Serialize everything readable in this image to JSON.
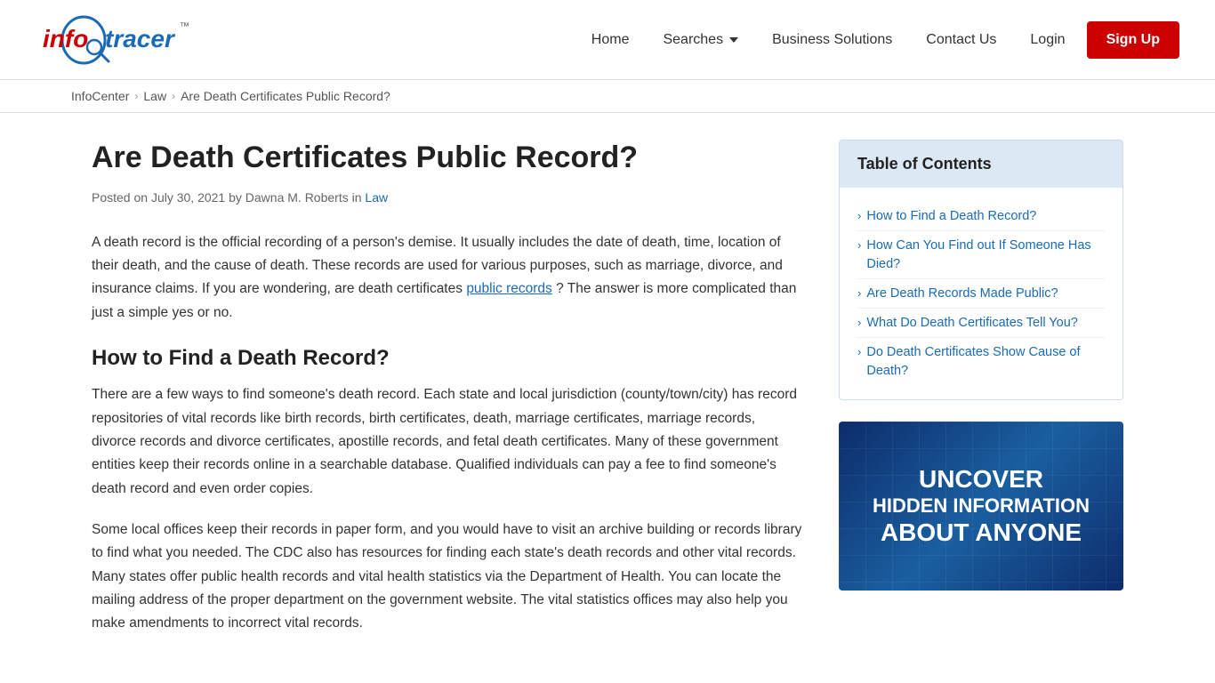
{
  "header": {
    "logo_text_red": "info",
    "logo_text_blue": "tracer",
    "logo_tm": "™",
    "nav": {
      "home": "Home",
      "searches": "Searches",
      "business_solutions": "Business Solutions",
      "contact_us": "Contact Us",
      "login": "Login",
      "signup": "Sign Up"
    }
  },
  "breadcrumb": {
    "infocenter": "InfoCenter",
    "law": "Law",
    "current": "Are Death Certificates Public Record?"
  },
  "article": {
    "title": "Are Death Certificates Public Record?",
    "meta": "Posted on July 30, 2021 by Dawna M. Roberts in",
    "meta_category": "Law",
    "intro_p1": "A death record is the official recording of a person's demise. It usually includes the date of death, time, location of their death, and the cause of death. These records are used for various purposes, such as marriage, divorce, and insurance claims. If you are wondering, are death certificates",
    "intro_link": "public records",
    "intro_p1_end": "? The answer is more complicated than just a simple yes or no.",
    "h2_1": "How to Find a Death Record?",
    "p2": "There are a few ways to find someone's death record. Each state and local jurisdiction (county/town/city) has record repositories of vital records like birth records, birth certificates, death, marriage certificates, marriage records, divorce records and divorce certificates, apostille records, and fetal death certificates. Many of these government entities keep their records online in a searchable database. Qualified individuals can pay a fee to find someone's death record and even order copies.",
    "p3": "Some local offices keep their records in paper form, and you would have to visit an archive building or records library to find what you needed. The CDC also has resources for finding each state's death records and other vital records. Many states offer public health records and vital health statistics via the Department of Health. You can locate the mailing address of the proper department on the government website. The vital statistics offices may also help you make amendments to incorrect vital records."
  },
  "toc": {
    "title": "Table of Contents",
    "items": [
      {
        "label": "How to Find a Death Record?"
      },
      {
        "label": "How Can You Find out If Someone Has Died?"
      },
      {
        "label": "Are Death Records Made Public?"
      },
      {
        "label": "What Do Death Certificates Tell You?"
      },
      {
        "label": "Do Death Certificates Show Cause of Death?"
      }
    ]
  },
  "banner": {
    "line1": "UNCOVER",
    "line2": "HIDDEN INFORMATION",
    "line3": "ABOUT ANYONE"
  }
}
